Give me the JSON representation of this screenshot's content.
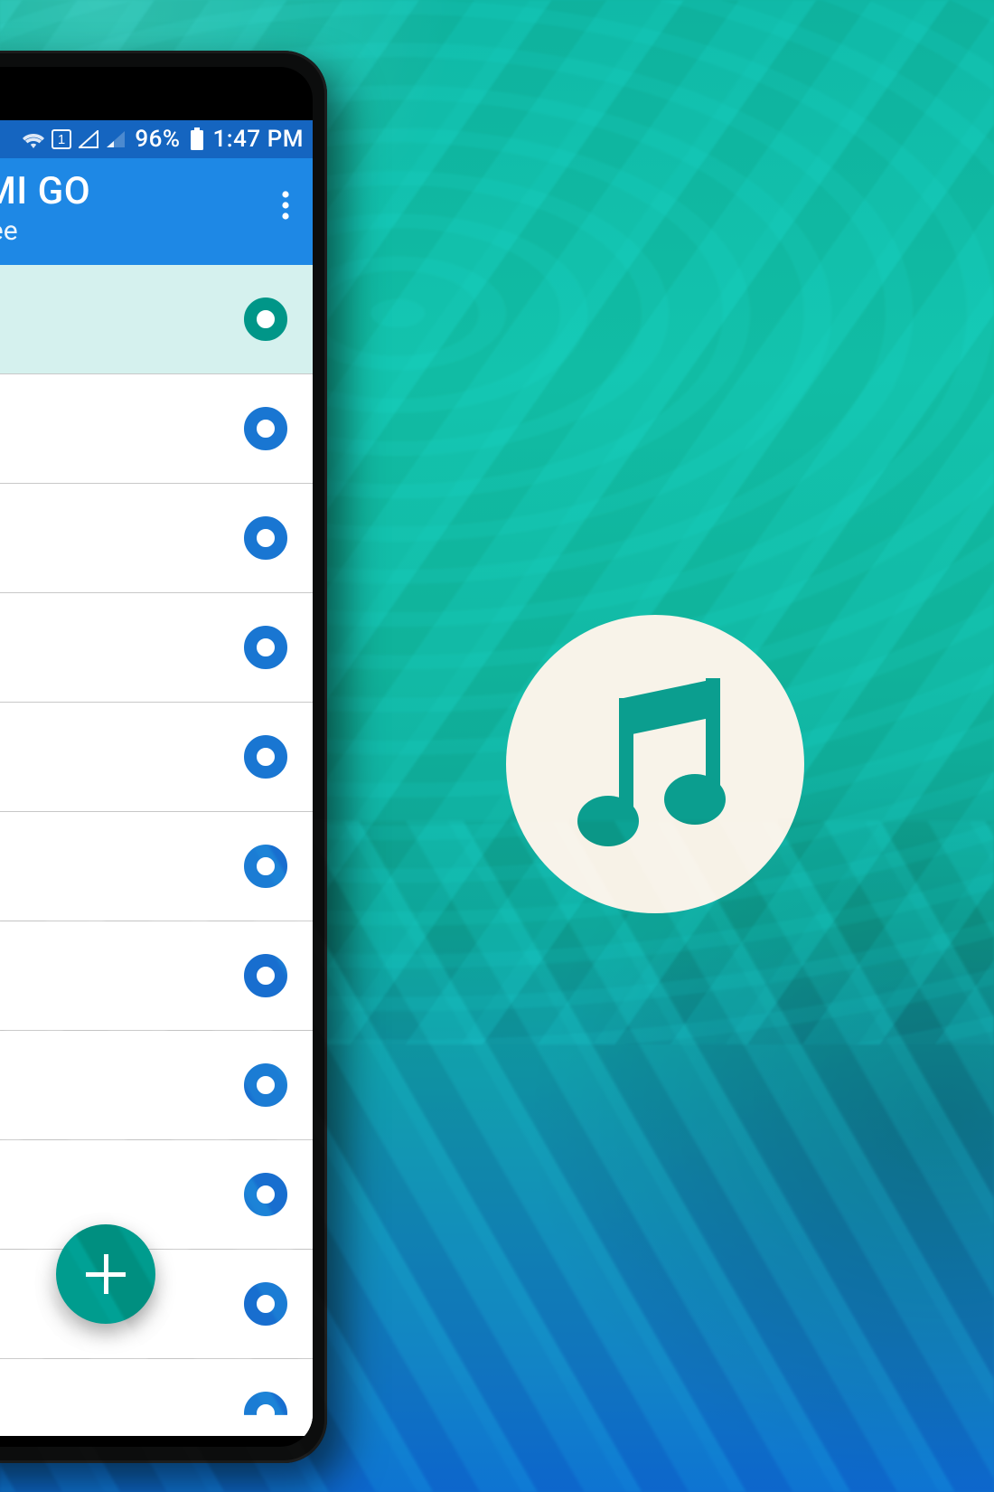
{
  "statusbar": {
    "battery_percent": "96%",
    "time": "1:47 PM",
    "sim_label": "1"
  },
  "appbar": {
    "title": "REDMI GO",
    "subtitle": "i Go Free"
  },
  "list": {
    "rows": [
      {
        "active": true,
        "ring": "teal"
      },
      {
        "active": false,
        "ring": "blue"
      },
      {
        "active": false,
        "ring": "blue"
      },
      {
        "active": false,
        "ring": "blue"
      },
      {
        "active": false,
        "ring": "blue"
      },
      {
        "active": false,
        "ring": "blue"
      },
      {
        "active": false,
        "ring": "blue"
      },
      {
        "active": false,
        "ring": "blue"
      },
      {
        "active": false,
        "ring": "blue"
      },
      {
        "active": false,
        "ring": "blue"
      },
      {
        "active": false,
        "ring": "blue",
        "partial": true
      }
    ]
  },
  "colors": {
    "primary": "#1e88e5",
    "primary_dark": "#1565c0",
    "accent": "#009688",
    "ring_blue": "#1976d2",
    "badge_bg": "#f8f3e9"
  }
}
